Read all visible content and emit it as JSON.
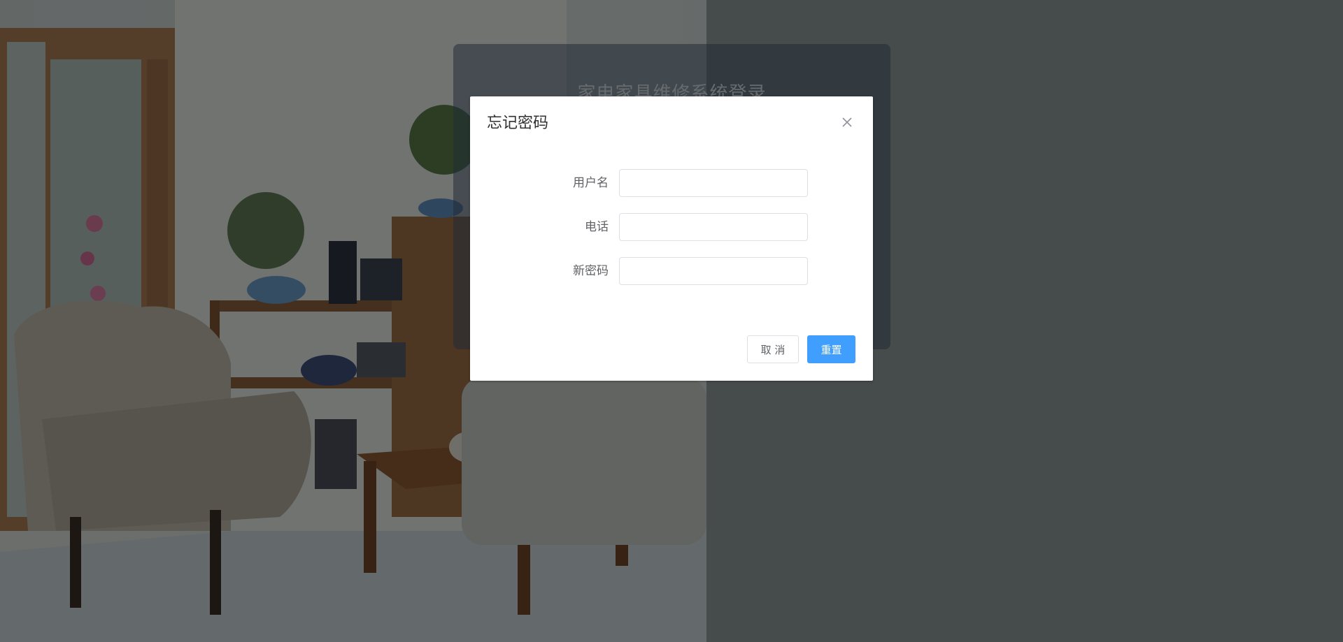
{
  "background": {
    "login_title": "家电家具维修系统登录"
  },
  "dialog": {
    "title": "忘记密码",
    "close_icon": "close-icon",
    "fields": [
      {
        "label": "用户名",
        "value": "",
        "placeholder": ""
      },
      {
        "label": "电话",
        "value": "",
        "placeholder": ""
      },
      {
        "label": "新密码",
        "value": "",
        "placeholder": ""
      }
    ],
    "cancel_label": "取 消",
    "reset_label": "重置"
  },
  "colors": {
    "primary": "#409eff",
    "mask": "rgba(0,0,0,0.5)"
  }
}
